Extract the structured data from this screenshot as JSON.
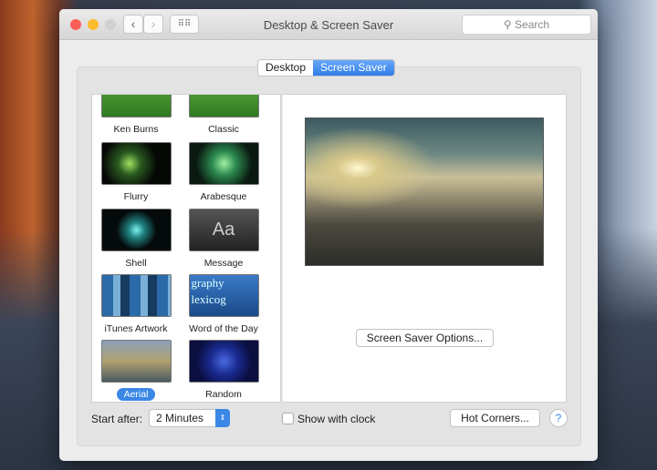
{
  "window": {
    "title": "Desktop & Screen Saver",
    "search_placeholder": "Search"
  },
  "tabs": [
    {
      "label": "Desktop",
      "active": false
    },
    {
      "label": "Screen Saver",
      "active": true
    }
  ],
  "savers": [
    {
      "label": "Ken Burns"
    },
    {
      "label": "Classic"
    },
    {
      "label": "Flurry"
    },
    {
      "label": "Arabesque"
    },
    {
      "label": "Shell"
    },
    {
      "label": "Message"
    },
    {
      "label": "iTunes Artwork"
    },
    {
      "label": "Word of the Day"
    },
    {
      "label": "Aerial",
      "selected": true
    },
    {
      "label": "Random"
    }
  ],
  "thumb_text": {
    "message": "Aa",
    "word": "graphy lexicog"
  },
  "options_button": "Screen Saver Options...",
  "start_after": {
    "label": "Start after:",
    "value": "2 Minutes"
  },
  "show_clock": {
    "label": "Show with clock",
    "checked": false
  },
  "hot_corners": "Hot Corners...",
  "help": "?"
}
